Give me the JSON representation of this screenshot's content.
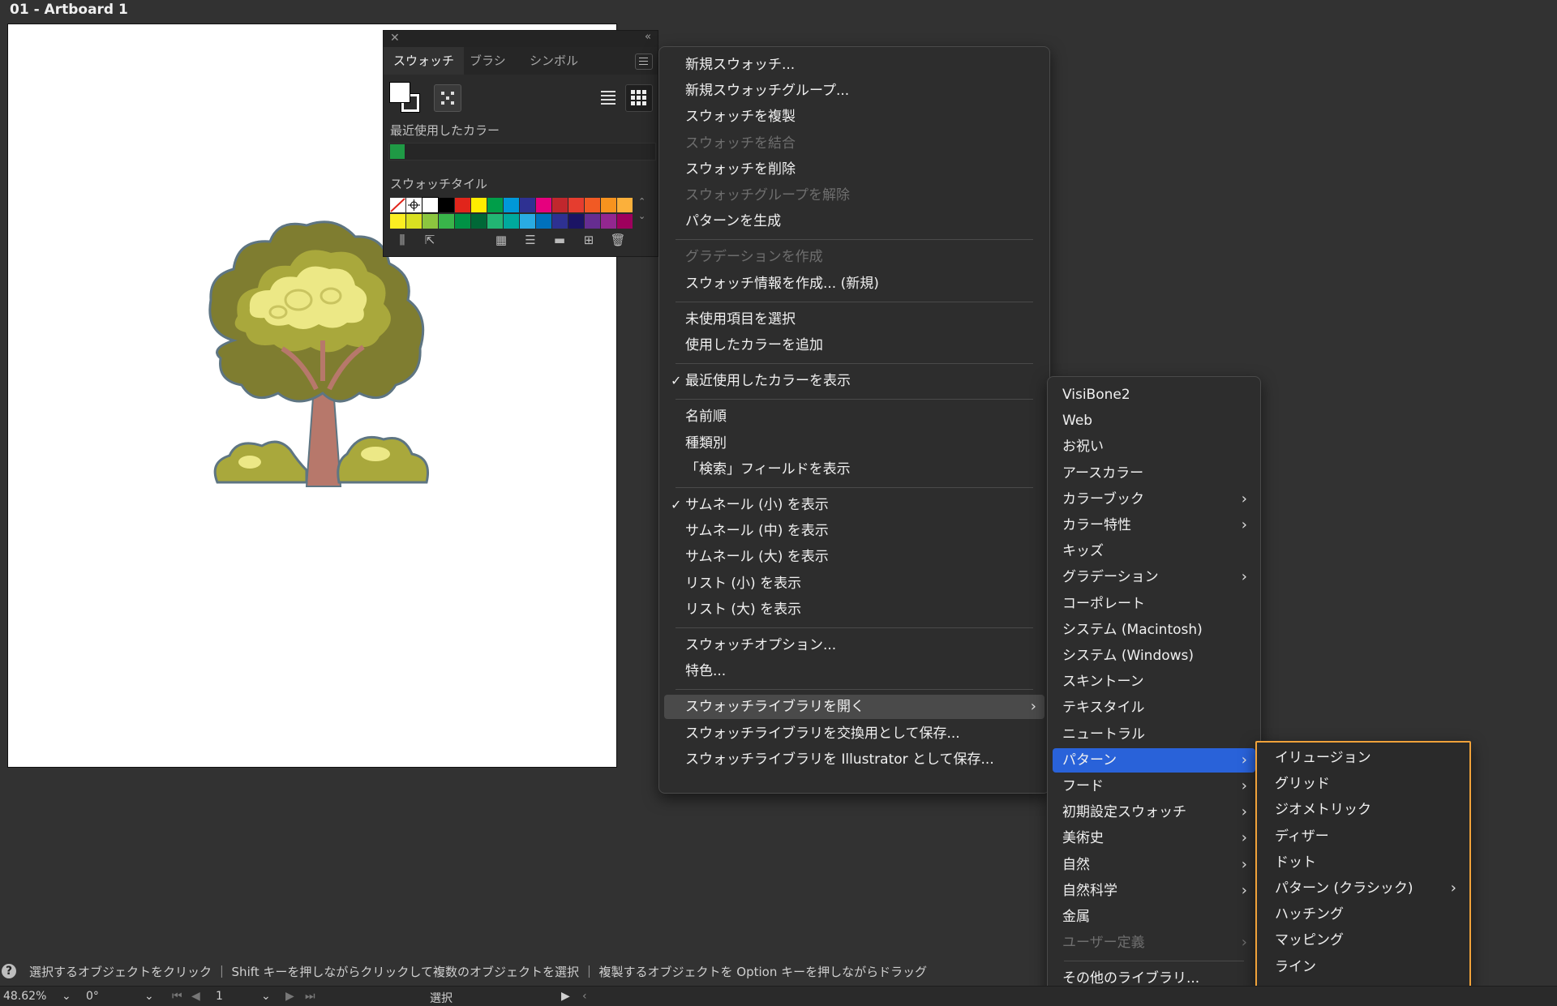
{
  "document": {
    "title": "01 - Artboard 1"
  },
  "swatches_panel": {
    "tabs": [
      "スウォッチ",
      "ブラシ",
      "シンボル"
    ],
    "recent_colors_label": "最近使用したカラー",
    "recent_color": "#1f9a45",
    "swatch_tile_label": "スウォッチタイル",
    "swatch_colors_row1": [
      "none",
      "registration",
      "#ffffff",
      "#000000",
      "#e1251b",
      "#ffec00",
      "#009e49",
      "#0098d9",
      "#2e3192",
      "#e6007e",
      "#c1272d",
      "#e53d2f",
      "#f15a24",
      "#f7931e",
      "#fbb03b"
    ],
    "swatch_colors_row2": [
      "#fcee21",
      "#d9e021",
      "#8cc63f",
      "#39b54a",
      "#009245",
      "#006837",
      "#22b573",
      "#00a99d",
      "#29abe2",
      "#0071bc",
      "#2e3192",
      "#1b1464",
      "#662d91",
      "#93278f",
      "#9e005d"
    ]
  },
  "context_menu": {
    "items": [
      {
        "label": "新規スウォッチ...",
        "disabled": false
      },
      {
        "label": "新規スウォッチグループ...",
        "disabled": false
      },
      {
        "label": "スウォッチを複製",
        "disabled": false
      },
      {
        "label": "スウォッチを結合",
        "disabled": true
      },
      {
        "label": "スウォッチを削除",
        "disabled": false
      },
      {
        "label": "スウォッチグループを解除",
        "disabled": true
      },
      {
        "label": "パターンを生成",
        "disabled": false
      },
      {
        "label": "グラデーションを作成",
        "disabled": true
      },
      {
        "label": "スウォッチ情報を作成... (新規)",
        "disabled": false
      },
      {
        "label": "未使用項目を選択",
        "disabled": false
      },
      {
        "label": "使用したカラーを追加",
        "disabled": false
      },
      {
        "label": "最近使用したカラーを表示",
        "checked": true
      },
      {
        "label": "名前順"
      },
      {
        "label": "種類別"
      },
      {
        "label": "「検索」フィールドを表示"
      },
      {
        "label": "サムネール (小) を表示",
        "checked": true
      },
      {
        "label": "サムネール (中) を表示"
      },
      {
        "label": "サムネール (大) を表示"
      },
      {
        "label": "リスト (小) を表示"
      },
      {
        "label": "リスト (大) を表示"
      },
      {
        "label": "スウォッチオプション..."
      },
      {
        "label": "特色..."
      },
      {
        "label": "スウォッチライブラリを開く",
        "submenu": true
      },
      {
        "label": "スウォッチライブラリを交換用として保存..."
      },
      {
        "label": "スウォッチライブラリを Illustrator として保存..."
      }
    ],
    "checkmark": "✓",
    "arrow": "›"
  },
  "library_submenu": {
    "items": [
      {
        "label": "VisiBone2"
      },
      {
        "label": "Web"
      },
      {
        "label": "お祝い"
      },
      {
        "label": "アースカラー"
      },
      {
        "label": "カラーブック",
        "submenu": true
      },
      {
        "label": "カラー特性",
        "submenu": true
      },
      {
        "label": "キッズ"
      },
      {
        "label": "グラデーション",
        "submenu": true
      },
      {
        "label": "コーポレート"
      },
      {
        "label": "システム (Macintosh)"
      },
      {
        "label": "システム (Windows)"
      },
      {
        "label": "スキントーン"
      },
      {
        "label": "テキスタイル"
      },
      {
        "label": "ニュートラル"
      },
      {
        "label": "パターン",
        "submenu": true,
        "highlighted": true
      },
      {
        "label": "フード",
        "submenu": true
      },
      {
        "label": "初期設定スウォッチ",
        "submenu": true
      },
      {
        "label": "美術史",
        "submenu": true
      },
      {
        "label": "自然",
        "submenu": true
      },
      {
        "label": "自然科学",
        "submenu": true
      },
      {
        "label": "金属"
      },
      {
        "label": "ユーザー定義",
        "submenu": true,
        "disabled": true
      },
      {
        "label": "その他のライブラリ..."
      }
    ]
  },
  "pattern_submenu": {
    "items": [
      {
        "label": "イリュージョン"
      },
      {
        "label": "グリッド"
      },
      {
        "label": "ジオメトリック"
      },
      {
        "label": "ディザー"
      },
      {
        "label": "ドット"
      },
      {
        "label": "パターン (クラシック)",
        "submenu": true
      },
      {
        "label": "ハッチング"
      },
      {
        "label": "マッピング"
      },
      {
        "label": "ライン"
      }
    ],
    "accent": "#f0a23a"
  },
  "status_bar": {
    "help_glyph": "?",
    "text": "選択するオブジェクトをクリック ｜ Shift キーを押しながらクリックして複数のオブジェクトを選択 ｜ 複製するオブジェクトを Option キーを押しながらドラッグ"
  },
  "nav_bar": {
    "zoom": "48.62%",
    "rotation": "0°",
    "artboard_number": "1",
    "tool": "選択"
  }
}
